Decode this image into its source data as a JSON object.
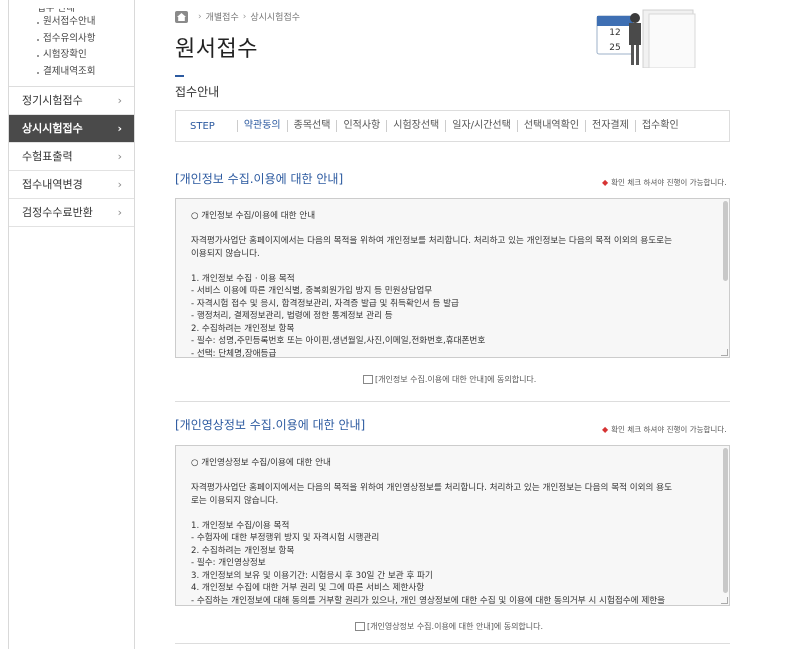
{
  "sidebar": {
    "top_cut": "접수 안내",
    "sub_items": [
      "원서접수안내",
      "접수유의사항",
      "시험장확인",
      "결제내역조회"
    ],
    "menu": [
      {
        "label": "정기시험접수",
        "active": false
      },
      {
        "label": "상시시험접수",
        "active": true
      },
      {
        "label": "수험표출력",
        "active": false
      },
      {
        "label": "접수내역변경",
        "active": false
      },
      {
        "label": "검정수수료반환",
        "active": false
      }
    ],
    "chevron": "›"
  },
  "breadcrumb": [
    "개별접수",
    "상시시험접수"
  ],
  "page_title": "원서접수",
  "subtitle": "접수안내",
  "deco_calendar": {
    "top": "12",
    "bottom": "25"
  },
  "steps": {
    "label": "STEP",
    "items": [
      "약관동의",
      "종목선택",
      "인적사항",
      "시험장선택",
      "일자/시간선택",
      "선택내역확인",
      "전자결제",
      "접수확인"
    ],
    "active_index": 0
  },
  "section1": {
    "title": "[개인정보 수집.이용에 대한 안내]",
    "notice": "확인 체크 하셔야 진행이 가능합니다.",
    "lines": [
      "○ 개인정보 수집/이용에 대한 안내",
      "",
      "자격평가사업단 홈페이지에서는 다음의 목적을 위하여 개인정보를 처리합니다. 처리하고 있는 개인정보는 다음의 목적 이외의 용도로는",
      "이용되지 않습니다.",
      "",
      "1. 개인정보 수집 · 이용 목적",
      "- 서비스 이용에 따른 개인식별, 중복회원가입 방지 등 민원상담업무",
      "- 자격시험 접수 및 응시, 합격정보관리, 자격증 발급 및 취득확인서 등 발급",
      "- 행정처리, 결제정보관리, 법령에 정한 통계정보 관리 등",
      "2. 수집하려는 개인정보 항목",
      "- 필수: 성명,주민등록번호 또는 아이핀,생년월일,사진,이메일,전화번호,휴대폰번호",
      "- 선택: 단체명,장애등급"
    ],
    "agree": "[개인정보 수집.이용에 대한 안내]에 동의합니다."
  },
  "section2": {
    "title": "[개인영상정보 수집.이용에 대한 안내]",
    "notice": "확인 체크 하셔야 진행이 가능합니다.",
    "lines": [
      "○ 개인영상정보 수집/이용에 대한 안내",
      "",
      "자격평가사업단 홈페이지에서는 다음의 목적을 위하여 개인영상정보를 처리합니다. 처리하고 있는 개인정보는 다음의 목적 이외의 용도",
      "로는 이용되지 않습니다.",
      "",
      "1. 개인정보 수집/이용 목적",
      "- 수험자에 대한 부정행위 방지 및 자격시험 시행관리",
      "2. 수집하려는 개인정보 항목",
      "- 필수: 개인영상정보",
      "3. 개인정보의 보유 및 이용기간: 시험응시 후 30일 간 보관 후 파기",
      "4. 개인정보 수집에 대한 거부 권리 및 그에 따른 서비스 제한사항",
      "- 수집하는 개인정보에 대해 동의를 거부할 권리가 있으나, 개인 영상정보에 대한 수집 및 이용에 대한 동의거부 시 시험접수에 제한을"
    ],
    "agree": "[개인영상정보 수집.이용에 대한 안내]에 동의합니다."
  },
  "colors": {
    "accent": "#2c5aa0",
    "active_menu": "#4a4a4a",
    "highlight": "#f5e600",
    "notice_mark": "#d63333"
  }
}
